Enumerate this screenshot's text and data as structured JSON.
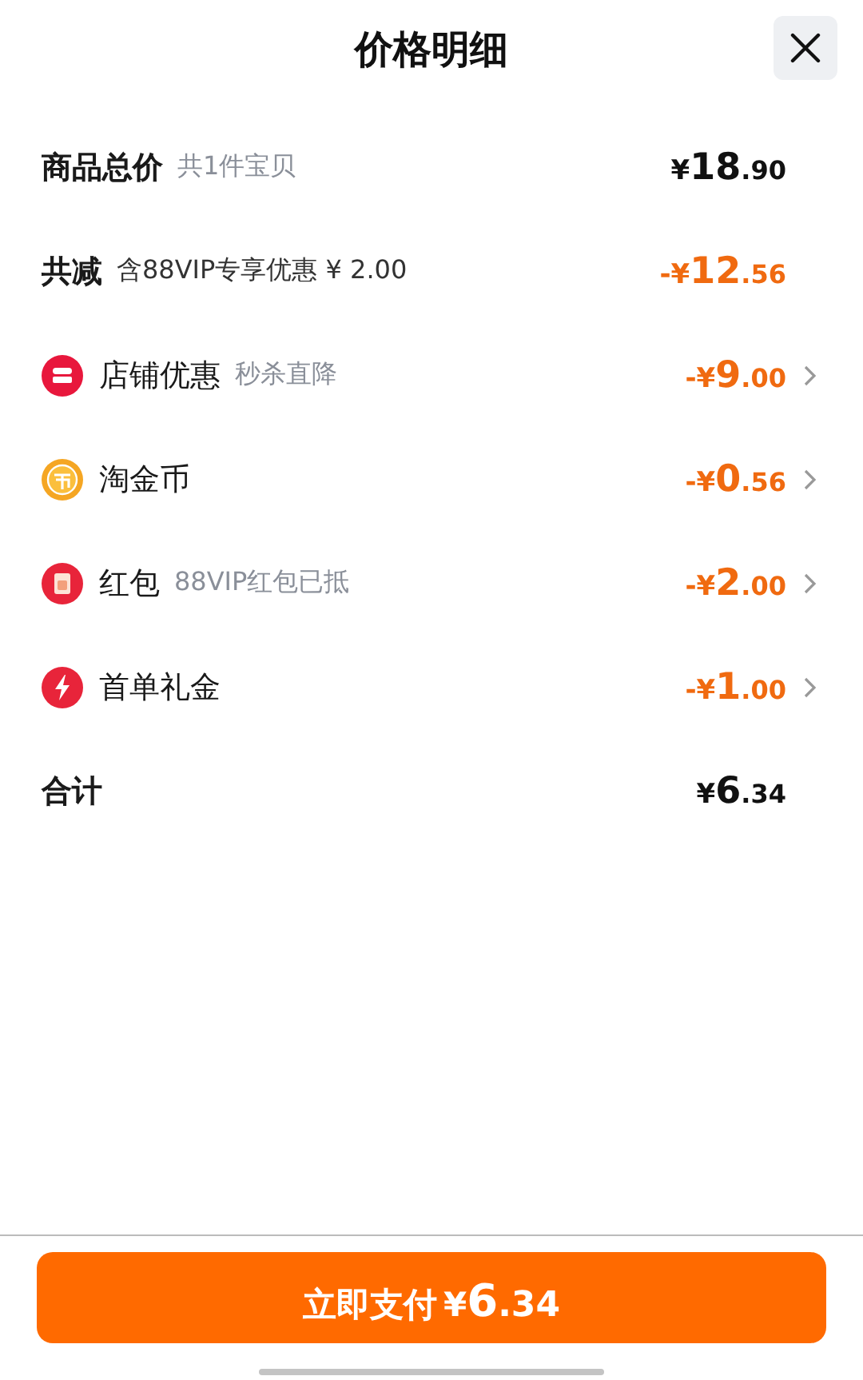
{
  "title": "价格明细",
  "rows": [
    {
      "kind": "summary",
      "label": "商品总价",
      "note": "共1件宝贝",
      "amount": {
        "prefix": "¥",
        "whole": "18",
        "cents": ".90"
      },
      "highlight": false
    },
    {
      "kind": "reduction",
      "label": "共减",
      "note": "含88VIP专享优惠 ¥ 2.00",
      "amount": {
        "prefix": "-¥",
        "whole": "12",
        "cents": ".56"
      },
      "highlight": true
    },
    {
      "kind": "store",
      "label": "店铺优惠",
      "note": "秒杀直降",
      "amount": {
        "prefix": "-¥",
        "whole": "9",
        "cents": ".00"
      },
      "highlight": true
    },
    {
      "kind": "coin",
      "label": "淘金币",
      "amount": {
        "prefix": "-¥",
        "whole": "0",
        "cents": ".56"
      },
      "highlight": true
    },
    {
      "kind": "envelope",
      "label": "红包",
      "note": "88VIP红包已抵",
      "amount": {
        "prefix": "-¥",
        "whole": "2",
        "cents": ".00"
      },
      "highlight": true
    },
    {
      "kind": "bolt",
      "label": "首单礼金",
      "amount": {
        "prefix": "-¥",
        "whole": "1",
        "cents": ".00"
      },
      "highlight": true
    },
    {
      "kind": "summary",
      "label": "合计",
      "amount": {
        "prefix": "¥",
        "whole": "6",
        "cents": ".34"
      },
      "highlight": false
    }
  ],
  "pay_button": {
    "label": "立即支付",
    "amount": {
      "prefix": "¥",
      "whole": "6",
      "cents": ".34"
    }
  }
}
